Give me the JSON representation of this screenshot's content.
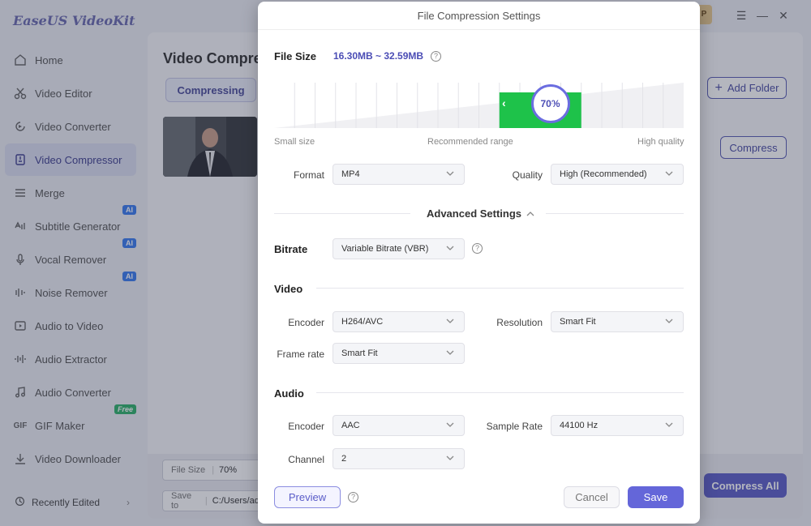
{
  "app": {
    "name": "EaseUS VideoKit",
    "pro_badge": "Pro",
    "window_controls": [
      "menu-icon",
      "minimize-icon",
      "close-icon"
    ]
  },
  "sidebar": {
    "items": [
      {
        "label": "Home",
        "icon": "home-icon"
      },
      {
        "label": "Video Editor",
        "icon": "scissors-icon"
      },
      {
        "label": "Video Converter",
        "icon": "convert-icon"
      },
      {
        "label": "Video Compressor",
        "icon": "compress-icon",
        "active": true
      },
      {
        "label": "Merge",
        "icon": "merge-icon"
      },
      {
        "label": "Subtitle Generator",
        "icon": "subtitle-icon",
        "badge": "AI"
      },
      {
        "label": "Vocal Remover",
        "icon": "microphone-icon",
        "badge": "AI"
      },
      {
        "label": "Noise Remover",
        "icon": "noise-icon",
        "badge": "AI"
      },
      {
        "label": "Audio to Video",
        "icon": "audio-video-icon"
      },
      {
        "label": "Audio Extractor",
        "icon": "waveform-icon"
      },
      {
        "label": "Audio Converter",
        "icon": "music-icon"
      },
      {
        "label": "GIF Maker",
        "icon": "gif-icon",
        "badge": "Free"
      },
      {
        "label": "Video Downloader",
        "icon": "download-icon"
      }
    ],
    "recent": "Recently Edited"
  },
  "main": {
    "title": "Video Compres",
    "tab": "Compressing",
    "add_folder": "Add Folder",
    "compress": "Compress",
    "file_size_label": "File Size",
    "file_size_value": "70%",
    "save_to_label": "Save to",
    "save_to_value": "C:/Users/adm",
    "compress_all": "Compress All"
  },
  "dialog": {
    "title": "File Compression Settings",
    "file_size_label": "File Size",
    "file_size_value": "16.30MB ~ 32.59MB",
    "slider": {
      "percent_label": "70%",
      "value": 70,
      "recommended_min": 55,
      "recommended_max": 75
    },
    "scale_labels": {
      "small": "Small size",
      "recommended": "Recommended range",
      "high": "High quality"
    },
    "format": {
      "label": "Format",
      "value": "MP4"
    },
    "quality": {
      "label": "Quality",
      "value": "High (Recommended)"
    },
    "advanced": "Advanced Settings",
    "bitrate": {
      "label": "Bitrate",
      "value": "Variable Bitrate (VBR)"
    },
    "video_section": "Video",
    "video_encoder": {
      "label": "Encoder",
      "value": "H264/AVC"
    },
    "resolution": {
      "label": "Resolution",
      "value": "Smart Fit"
    },
    "frame_rate": {
      "label": "Frame rate",
      "value": "Smart Fit"
    },
    "audio_section": "Audio",
    "audio_encoder": {
      "label": "Encoder",
      "value": "AAC"
    },
    "sample_rate": {
      "label": "Sample Rate",
      "value": "44100 Hz"
    },
    "channel": {
      "label": "Channel",
      "value": "2"
    },
    "preview": "Preview",
    "cancel": "Cancel",
    "save": "Save"
  },
  "colors": {
    "accent": "#6466d9",
    "slider_green": "#1ec24a",
    "value_purple": "#4b4db5"
  }
}
